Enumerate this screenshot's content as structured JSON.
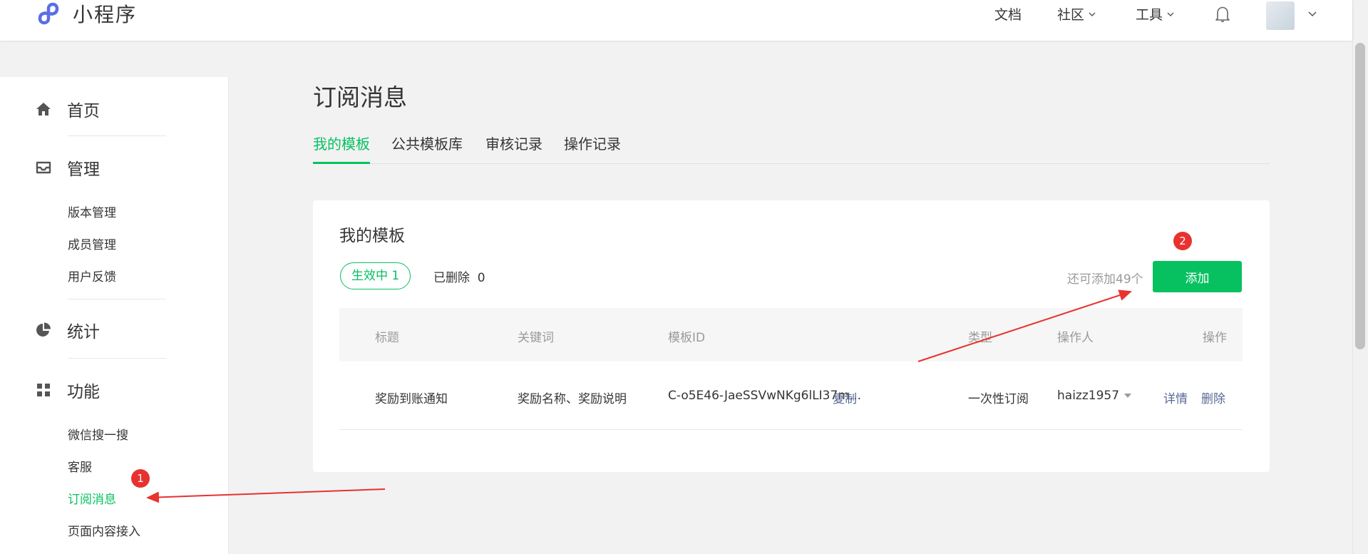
{
  "header": {
    "app_title": "小程序",
    "nav": [
      {
        "label": "文档"
      },
      {
        "label": "社区"
      },
      {
        "label": "工具"
      }
    ]
  },
  "sidebar": {
    "sections": [
      {
        "label": "首页",
        "icon": "home-icon",
        "items": []
      },
      {
        "label": "管理",
        "icon": "inbox-icon",
        "items": [
          "版本管理",
          "成员管理",
          "用户反馈"
        ]
      },
      {
        "label": "统计",
        "icon": "pie-chart-icon",
        "items": []
      },
      {
        "label": "功能",
        "icon": "grid-icon",
        "items": [
          "微信搜一搜",
          "客服",
          "订阅消息",
          "页面内容接入"
        ]
      }
    ],
    "active_item": "订阅消息"
  },
  "main": {
    "title": "订阅消息",
    "tabs": [
      {
        "label": "我的模板",
        "active": true
      },
      {
        "label": "公共模板库",
        "active": false
      },
      {
        "label": "审核记录",
        "active": false
      },
      {
        "label": "操作记录",
        "active": false
      }
    ],
    "card": {
      "title": "我的模板",
      "filter_active": "生效中 1",
      "filter_deleted": "已删除  0",
      "remaining": "还可添加49个",
      "add_label": "添加",
      "columns": [
        "标题",
        "关键词",
        "模板ID",
        "类型",
        "操作人",
        "操作"
      ],
      "rows": [
        {
          "title": "奖励到账通知",
          "keywords": "奖励名称、奖励说明",
          "template_id": "C-o5E46-JaeSSVwNKg6lLI37m...",
          "copy": "复制",
          "type": "一次性订阅",
          "operator": "haizz1957",
          "detail": "详情",
          "delete": "删除"
        }
      ]
    }
  },
  "annotations": [
    {
      "label": "1"
    },
    {
      "label": "2"
    }
  ],
  "colors": {
    "accent": "#07c160",
    "link": "#576b95",
    "annotation": "#e8322f"
  }
}
